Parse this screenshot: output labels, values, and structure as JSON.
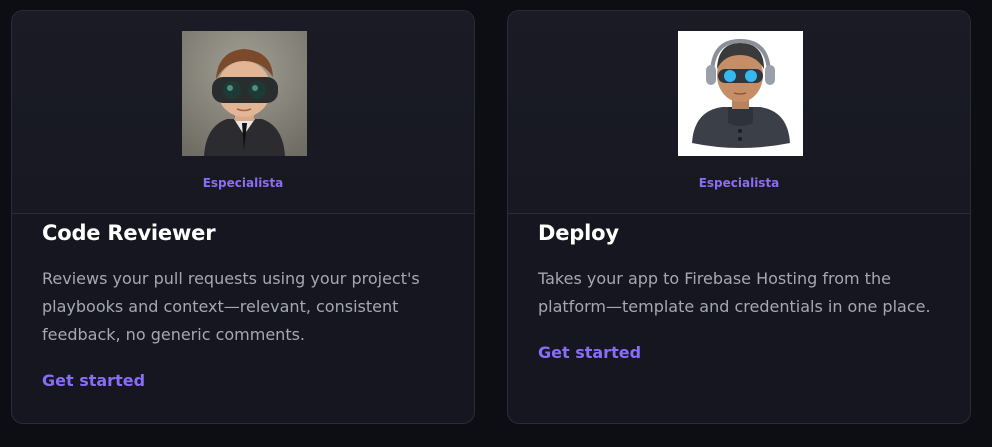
{
  "cards": [
    {
      "badge": "Especialista",
      "title": "Code Reviewer",
      "description": "Reviews your pull requests using your project's playbooks and context—relevant, consistent feedback, no generic comments.",
      "cta": "Get started",
      "avatar_icon": "goggles-businessman-avatar"
    },
    {
      "badge": "Especialista",
      "title": "Deploy",
      "description": "Takes your app to Firebase Hosting from the platform—template and credentials in one place.",
      "cta": "Get started",
      "avatar_icon": "headphones-robot-avatar"
    }
  ],
  "colors": {
    "accent": "#8b6cf6",
    "background": "#0d0e13",
    "card": "#151620",
    "title": "#ffffff",
    "description": "#a5a7b4"
  }
}
